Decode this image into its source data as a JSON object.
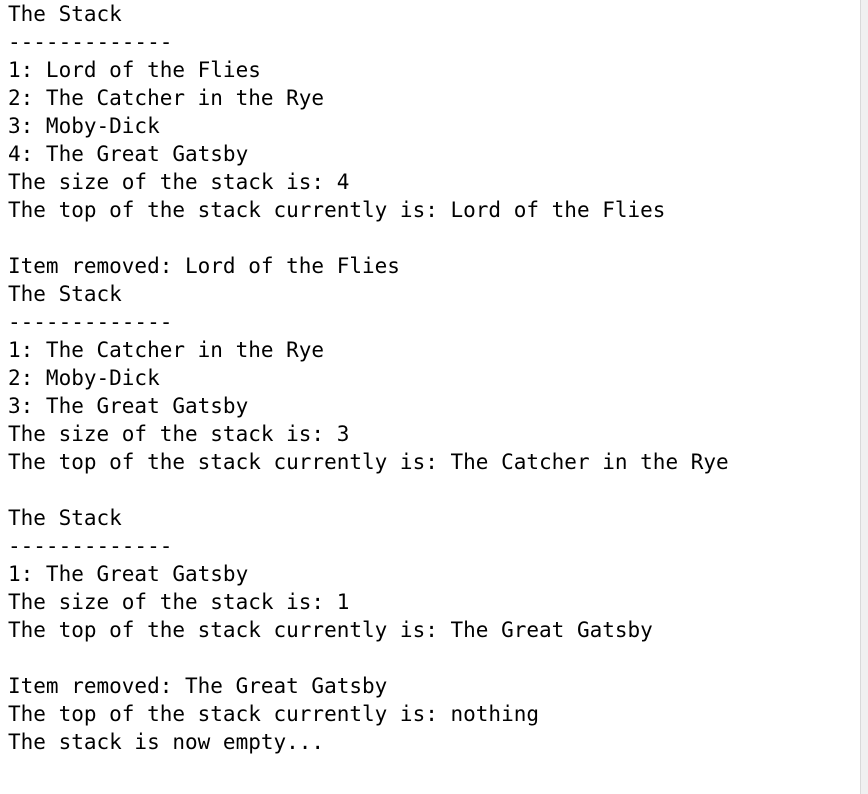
{
  "console": {
    "lines": [
      "The Stack",
      "-------------",
      "1: Lord of the Flies",
      "2: The Catcher in the Rye",
      "3: Moby-Dick",
      "4: The Great Gatsby",
      "The size of the stack is: 4",
      "The top of the stack currently is: Lord of the Flies",
      "",
      "Item removed: Lord of the Flies",
      "The Stack",
      "-------------",
      "1: The Catcher in the Rye",
      "2: Moby-Dick",
      "3: The Great Gatsby",
      "The size of the stack is: 3",
      "The top of the stack currently is: The Catcher in the Rye",
      "",
      "The Stack",
      "-------------",
      "1: The Great Gatsby",
      "The size of the stack is: 1",
      "The top of the stack currently is: The Great Gatsby",
      "",
      "Item removed: The Great Gatsby",
      "The top of the stack currently is: nothing",
      "The stack is now empty..."
    ]
  }
}
